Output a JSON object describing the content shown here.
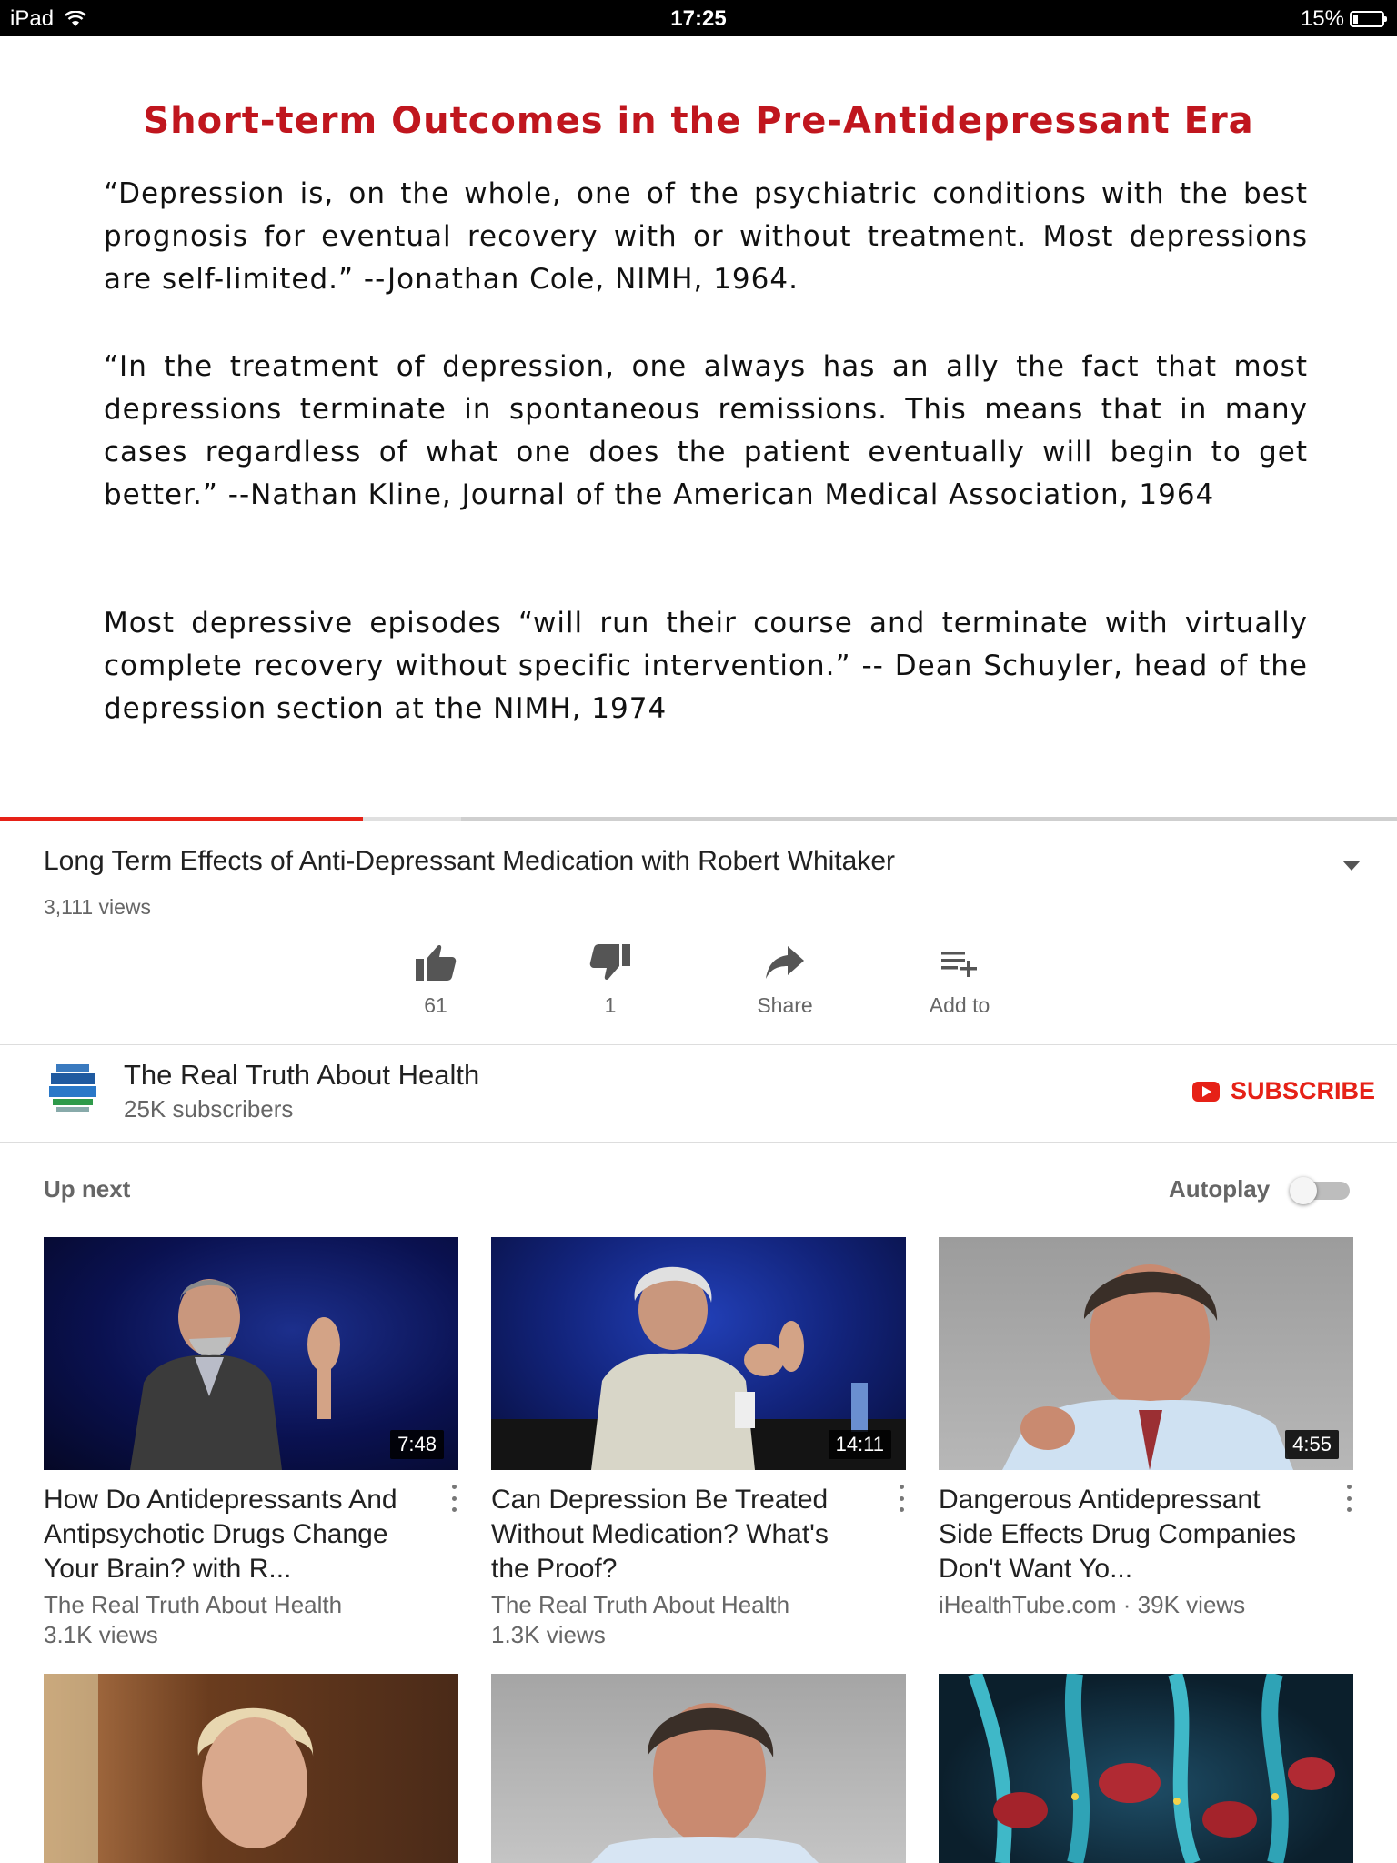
{
  "status_bar": {
    "device": "iPad",
    "time": "17:25",
    "battery": "15%"
  },
  "video_frame": {
    "slide_title": "Short-term Outcomes in the Pre-Antidepressant Era",
    "quotes": [
      "“Depression is, on the whole, one of the psychiatric conditions with the best prognosis for eventual recovery with or without treatment. Most depressions are self-limited.” --Jonathan Cole, NIMH, 1964.",
      "“In the treatment of depression, one always has an ally the fact that most depressions terminate in spontaneous remissions. This means that in many cases regardless of what one does the patient eventually will begin to get better.” --Nathan Kline, Journal of the American Medical Association, 1964",
      "Most depressive episodes “will run their course and terminate with virtually complete recovery without specific intervention.” -- Dean Schuyler, head of the depression section at the NIMH, 1974"
    ],
    "progress_played_fraction": 0.26,
    "progress_buffered_fraction": 0.33
  },
  "video_info": {
    "title": "Long Term Effects of Anti-Depressant Medication with Robert Whitaker",
    "views": "3,111 views",
    "actions": {
      "like_count": "61",
      "dislike_count": "1",
      "share_label": "Share",
      "add_label": "Add to"
    }
  },
  "channel": {
    "name": "The Real Truth About Health",
    "subscribers": "25K subscribers",
    "subscribe_label": "SUBSCRIBE"
  },
  "up_next": {
    "label": "Up next",
    "autoplay_label": "Autoplay",
    "autoplay_on": false,
    "videos": [
      {
        "title": "How Do Antidepressants And Antipsychotic Drugs Change Your Brain? with R...",
        "channel": "The Real Truth About Health",
        "views": "3.1K views",
        "duration": "7:48"
      },
      {
        "title": "Can Depression Be Treated Without Medication? What's the Proof?",
        "channel": "The Real Truth About Health",
        "views": "1.3K views",
        "duration": "14:11"
      },
      {
        "title": "Dangerous Antidepressant Side Effects Drug Companies Don't Want Yo...",
        "meta": "iHealthTube.com · 39K views",
        "duration": "4:55"
      }
    ]
  },
  "colors": {
    "accent_red": "#e62117",
    "slide_title_red": "#c0161e"
  }
}
